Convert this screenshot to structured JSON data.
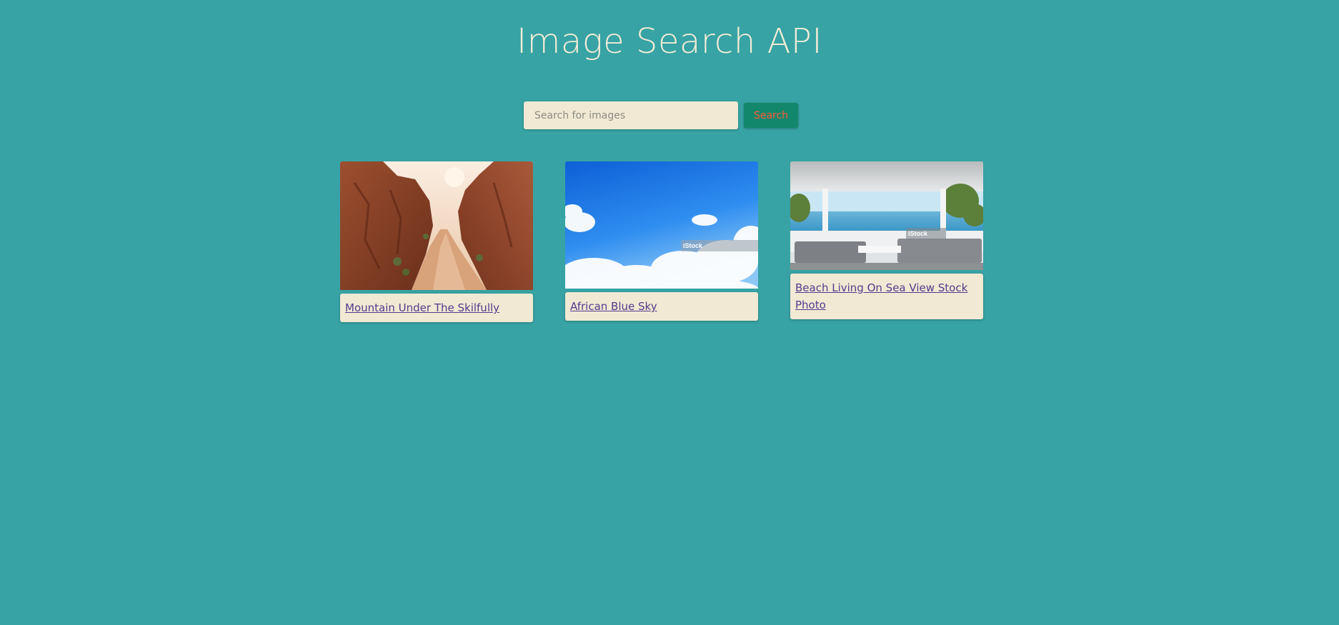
{
  "page": {
    "title": "Image Search API"
  },
  "search": {
    "placeholder": "Search for images",
    "value": "",
    "button_label": "Search"
  },
  "results": [
    {
      "caption": "Mountain Under The Skilfully",
      "image_subject": "red rock canyon"
    },
    {
      "caption": "African Blue Sky",
      "image_subject": "blue sky with clouds",
      "watermark": "iStock"
    },
    {
      "caption": "Beach Living On Sea View Stock Photo",
      "image_subject": "living room with sea view",
      "watermark": "iStock"
    }
  ],
  "colors": {
    "background": "#37a3a4",
    "title": "#f3ecd6",
    "card": "#f1e9d3",
    "button": "#13876b",
    "button_text": "#ff5a3c",
    "link": "#553a8f"
  }
}
